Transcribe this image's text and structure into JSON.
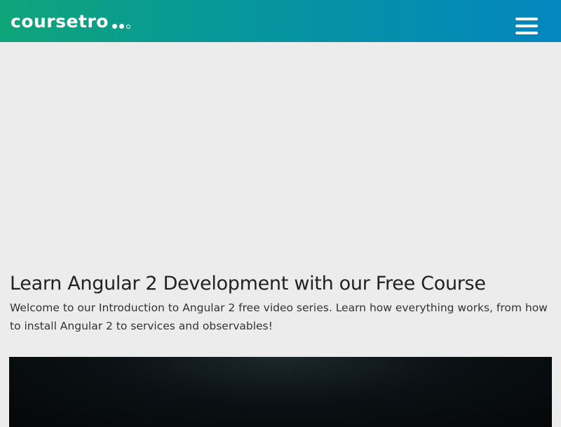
{
  "header": {
    "logo_text": "coursetro",
    "menu_icon": "hamburger-menu-icon",
    "gradient_start": "#0fa57a",
    "gradient_end": "#0486bf"
  },
  "hero": {
    "title": "Learn Angular 2 Development with our Free Course",
    "description": "Welcome to our Introduction to Angular 2 free video series. Learn how everything works, from how to install Angular 2 to services and observables!"
  },
  "video": {
    "background_color": "#0b1114"
  }
}
